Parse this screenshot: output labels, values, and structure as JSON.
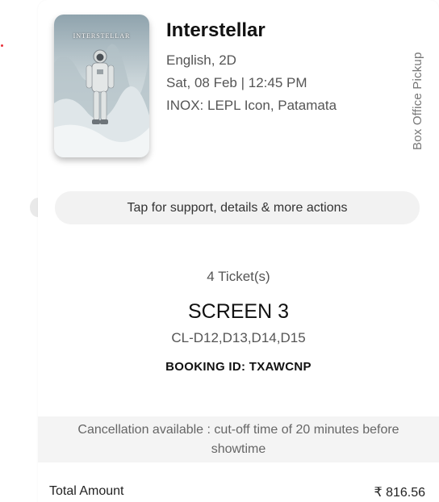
{
  "movie": {
    "title": "Interstellar",
    "poster_text": "INTERSTELLAR",
    "language_format": "English, 2D",
    "datetime": "Sat, 08 Feb | 12:45 PM",
    "venue": "INOX: LEPL Icon, Patamata"
  },
  "pickup_label": "Box Office Pickup",
  "support_label": "Tap for support, details & more actions",
  "ticket": {
    "count_label": "4 Ticket(s)",
    "screen": "SCREEN 3",
    "seats": "CL-D12,D13,D14,D15",
    "booking_id": "BOOKING ID: TXAWCNP"
  },
  "cancellation_text": "Cancellation available : cut-off time of 20 minutes before showtime",
  "total": {
    "label": "Total Amount",
    "value": "₹ 816.56"
  },
  "colors": {
    "accent_dot": "#e8323c",
    "support_bg": "#f2f2f2",
    "cancel_bg": "#f4f4f4"
  }
}
